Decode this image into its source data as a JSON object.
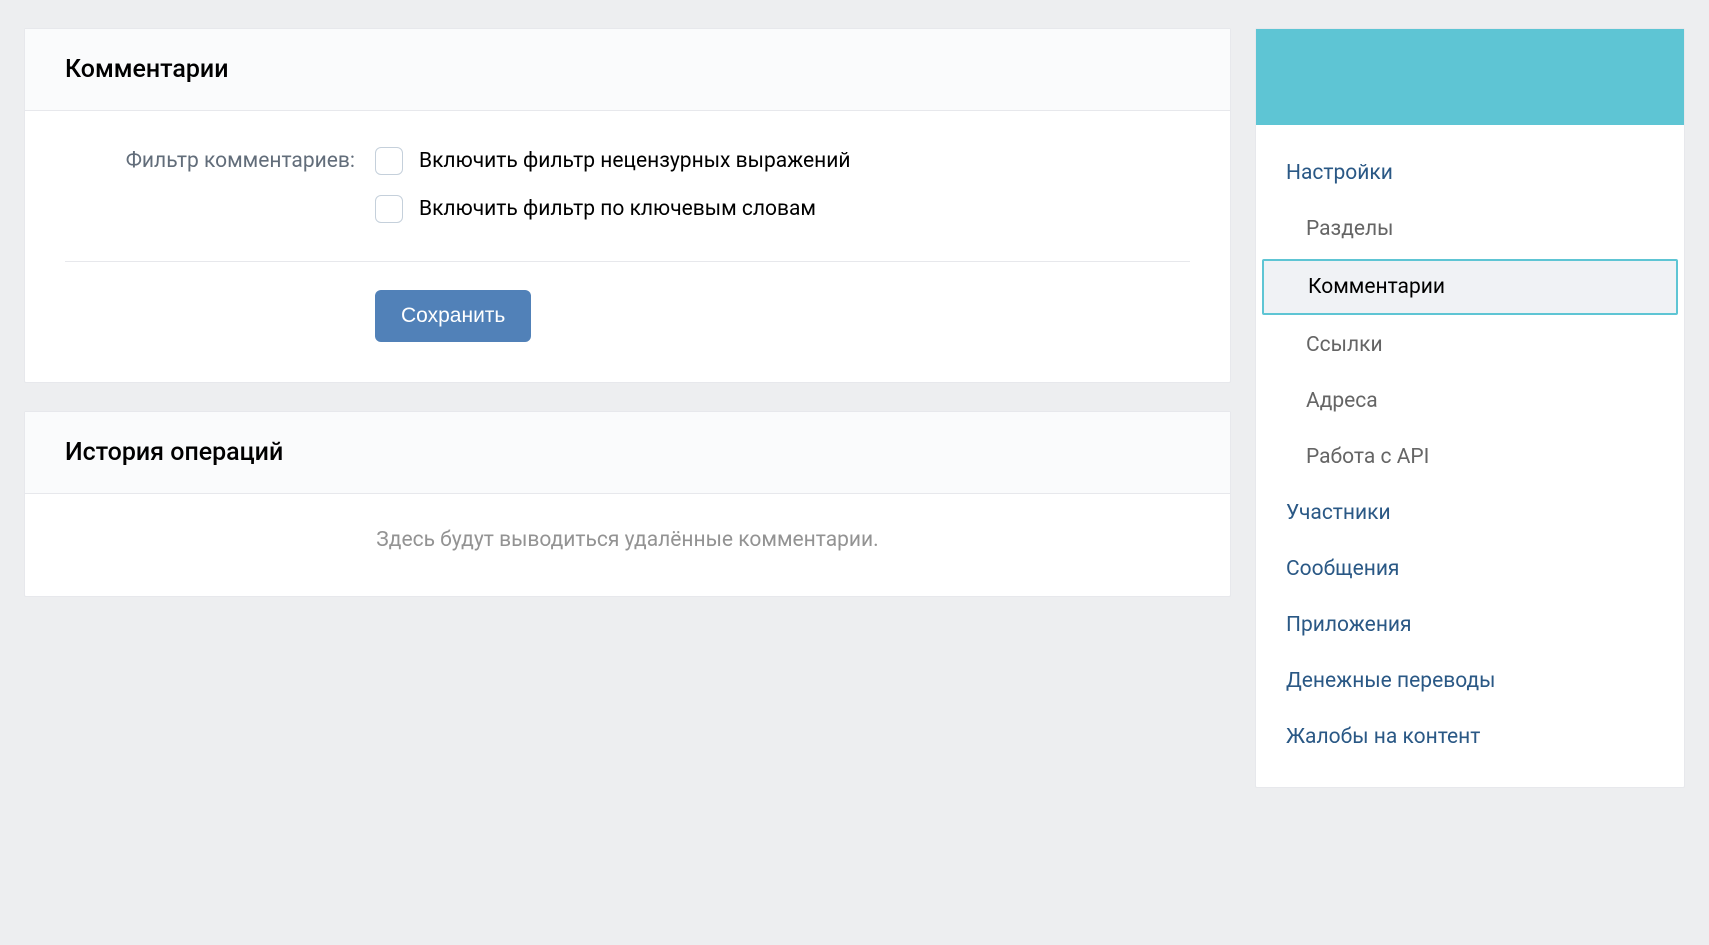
{
  "comments_card": {
    "title": "Комментарии",
    "filter_label": "Фильтр комментариев:",
    "checkbox_profanity": "Включить фильтр нецензурных выражений",
    "checkbox_keywords": "Включить фильтр по ключевым словам",
    "save_button": "Сохранить"
  },
  "history_card": {
    "title": "История операций",
    "empty_text": "Здесь будут выводиться удалённые комментарии."
  },
  "sidebar": {
    "settings": "Настройки",
    "sections": "Разделы",
    "comments": "Комментарии",
    "links": "Ссылки",
    "addresses": "Адреса",
    "api": "Работа с API",
    "members": "Участники",
    "messages": "Сообщения",
    "apps": "Приложения",
    "money": "Денежные переводы",
    "reports": "Жалобы на контент"
  }
}
